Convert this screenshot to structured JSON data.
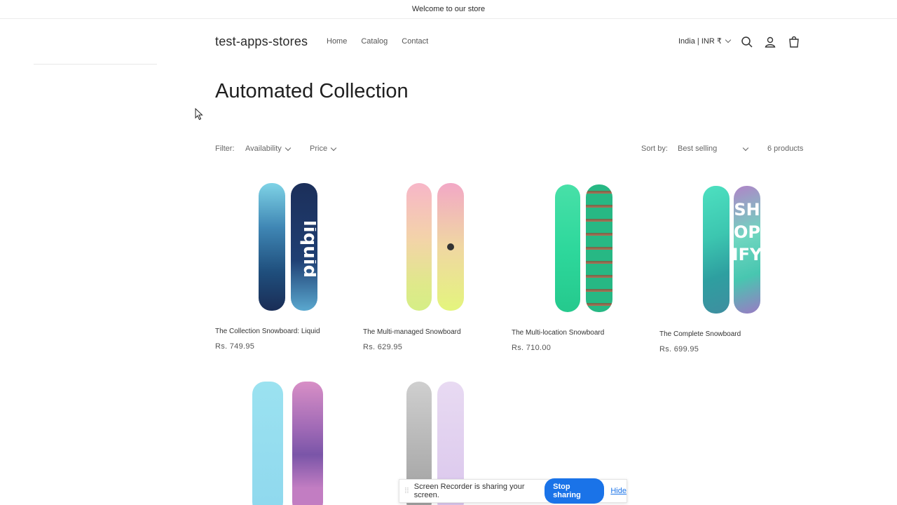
{
  "announcement": "Welcome to our store",
  "header": {
    "logo": "test-apps-stores",
    "nav": [
      "Home",
      "Catalog",
      "Contact"
    ],
    "country": "India | INR ₹",
    "icons": [
      "search-icon",
      "account-icon",
      "cart-icon"
    ]
  },
  "collection": {
    "title": "Automated Collection"
  },
  "filters": {
    "label": "Filter:",
    "availability": "Availability",
    "price": "Price",
    "sort_label": "Sort by:",
    "sort_value": "Best selling",
    "count": "6 products"
  },
  "products": [
    {
      "name": "The Collection Snowboard: Liquid",
      "price": "Rs. 749.95"
    },
    {
      "name": "The Multi-managed Snowboard",
      "price": "Rs. 629.95"
    },
    {
      "name": "The Multi-location Snowboard",
      "price": "Rs. 710.00"
    },
    {
      "name": "The Complete Snowboard",
      "price": "Rs. 699.95"
    },
    {
      "name": "",
      "price": ""
    },
    {
      "name": "",
      "price": ""
    }
  ],
  "share_bar": {
    "message": "Screen Recorder is sharing your screen.",
    "stop": "Stop sharing",
    "hide": "Hide"
  },
  "colors": {
    "accent": "#1a73e8"
  }
}
